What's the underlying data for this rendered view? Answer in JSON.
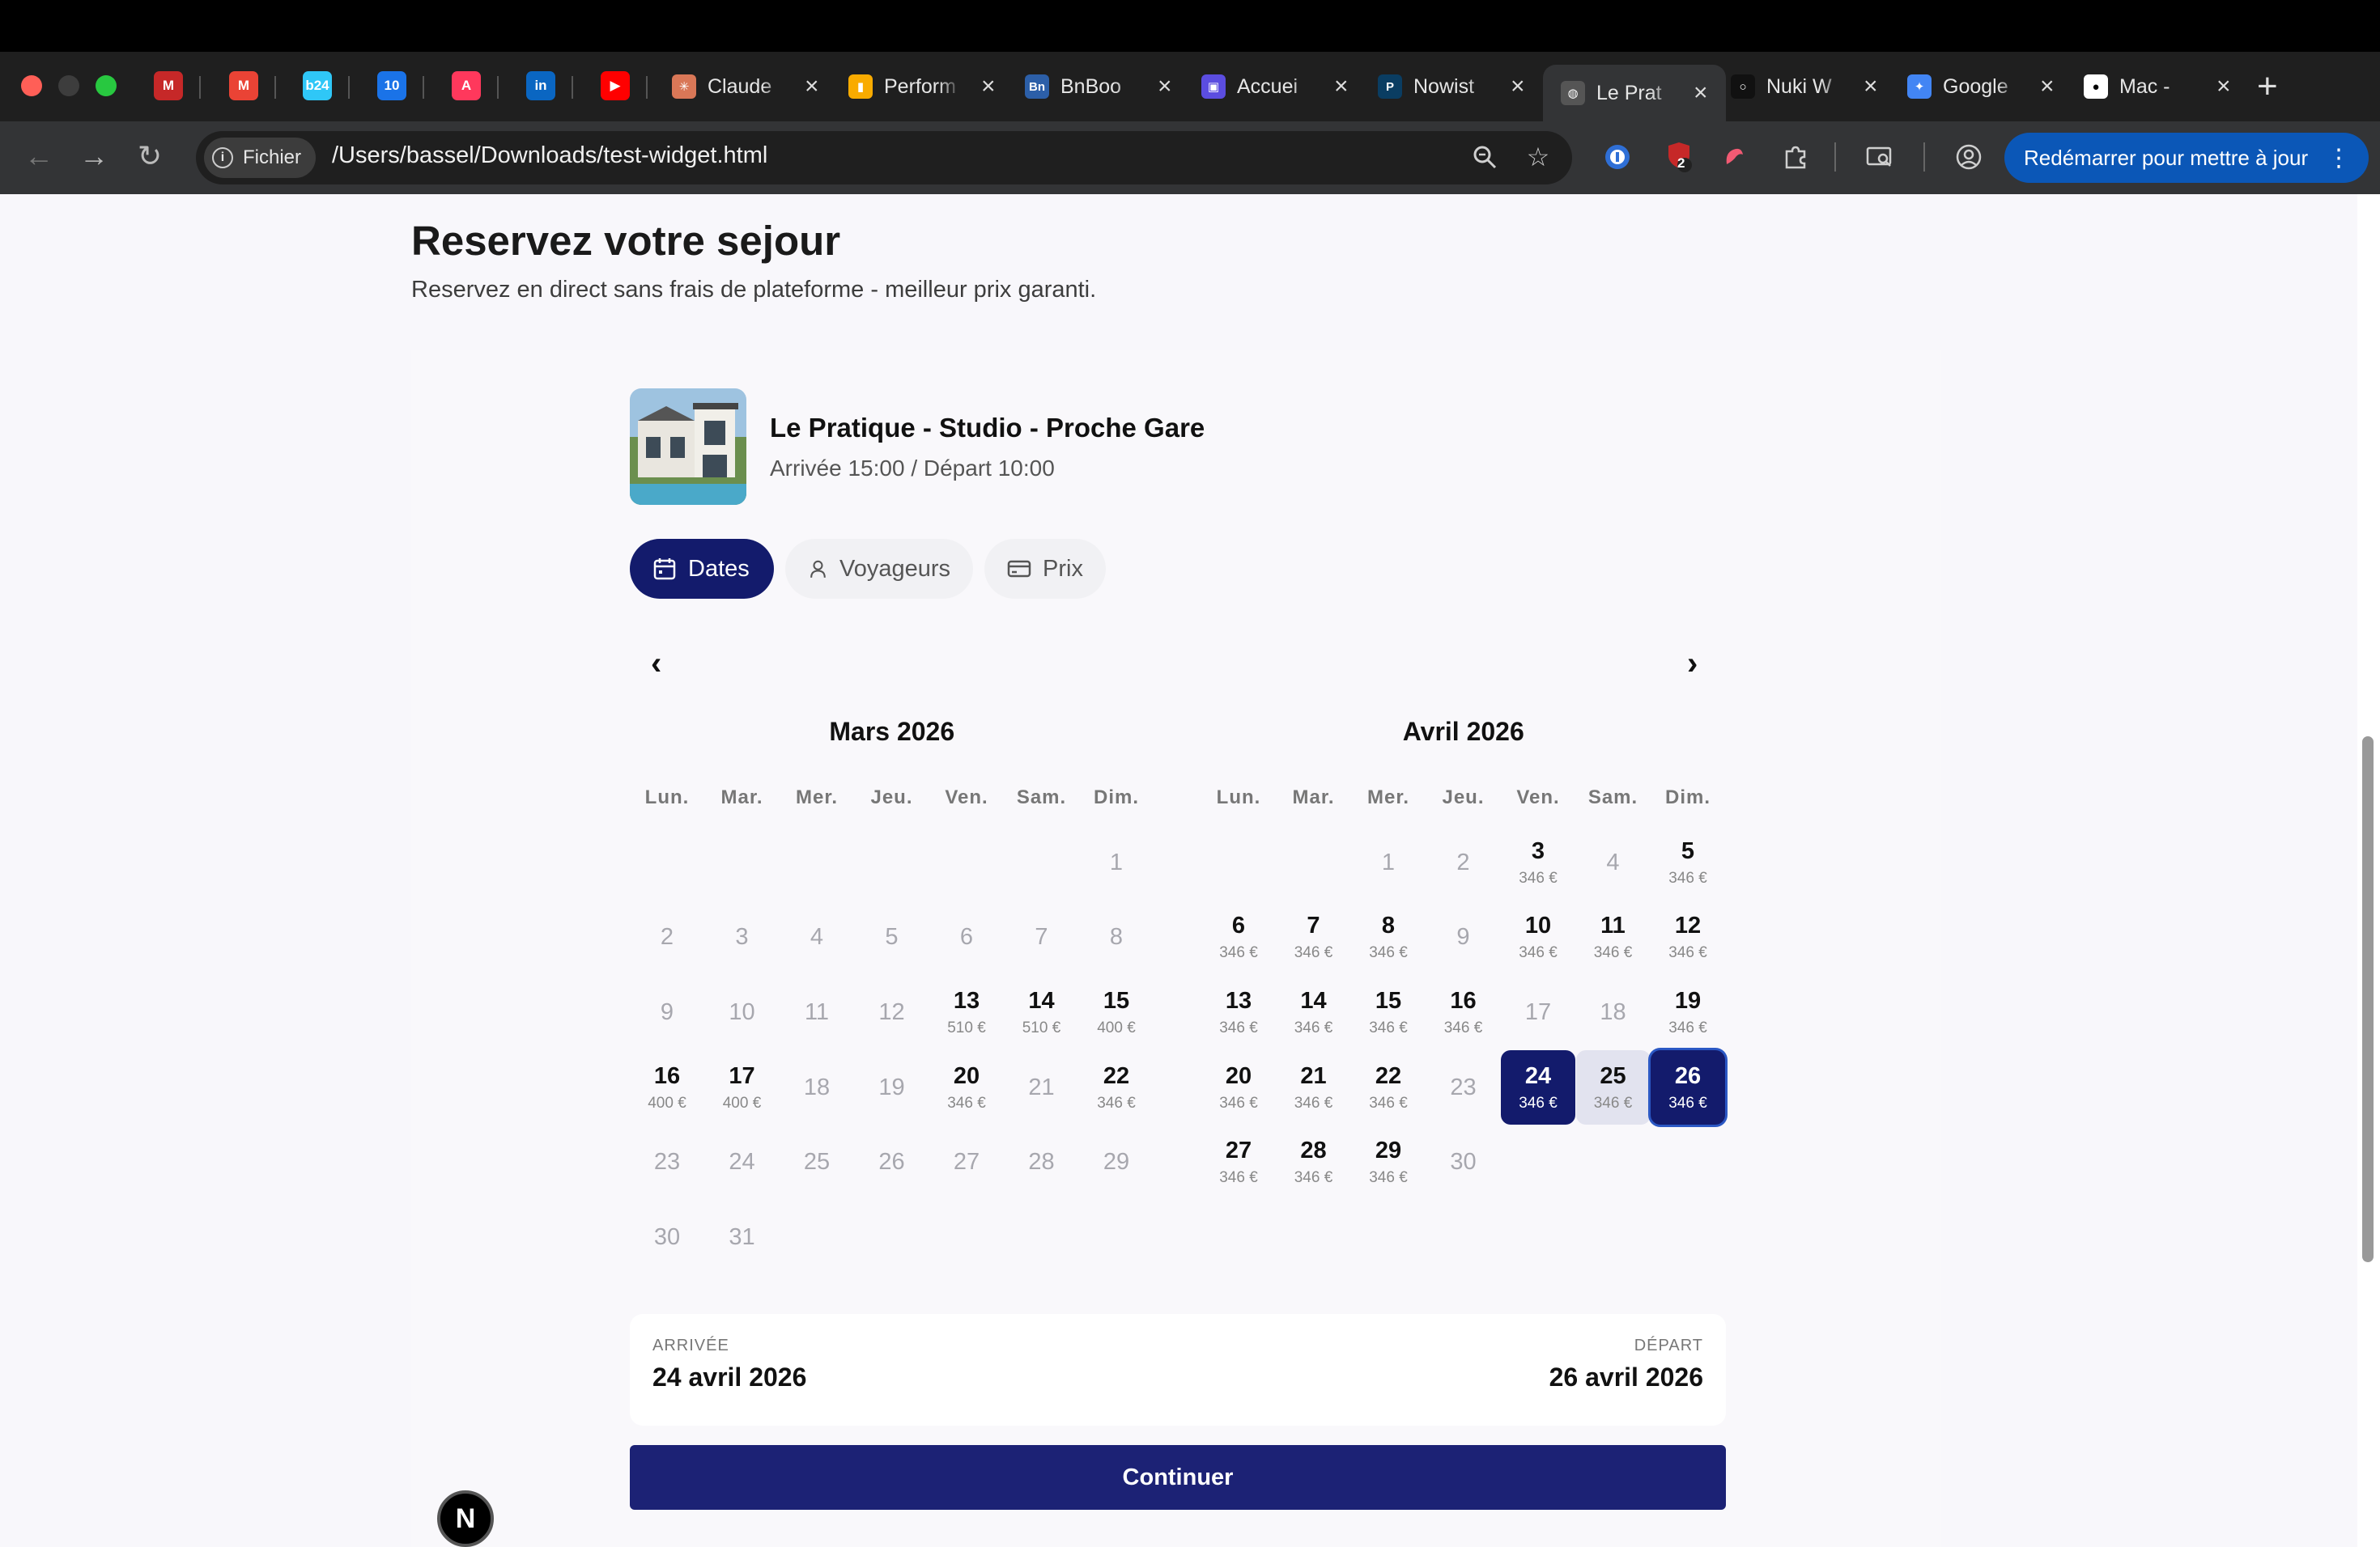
{
  "browser": {
    "pinned_tabs": [
      {
        "name": "gmail-zoho-icon",
        "label": "M",
        "color": "#c62828"
      },
      {
        "name": "gmail-icon",
        "label": "M",
        "color": "#ea4335"
      },
      {
        "name": "bitrix24-icon",
        "label": "b24",
        "color": "#2fc7f7"
      },
      {
        "name": "calendar-icon",
        "label": "10",
        "color": "#1a73e8"
      },
      {
        "name": "airbnb-icon",
        "label": "A",
        "color": "#ff385c"
      },
      {
        "name": "linkedin-icon",
        "label": "in",
        "color": "#0a66c2"
      },
      {
        "name": "youtube-icon",
        "label": "▶",
        "color": "#ff0000"
      }
    ],
    "tabs": [
      {
        "title": "Claude",
        "fav": "✳",
        "favcolor": "#d97757"
      },
      {
        "title": "Perform",
        "fav": "▮",
        "favcolor": "#f9ab00"
      },
      {
        "title": "BnBoo",
        "fav": "Bn",
        "favcolor": "#2c5fa8"
      },
      {
        "title": "Accuei",
        "fav": "▣",
        "favcolor": "#5b4de0"
      },
      {
        "title": "Nowist",
        "fav": "P",
        "favcolor": "#0a3d62"
      },
      {
        "title": "Le Prat",
        "fav": "◍",
        "favcolor": "#555"
      },
      {
        "title": "Nuki W",
        "fav": "○",
        "favcolor": "#111"
      },
      {
        "title": "Google",
        "fav": "✦",
        "favcolor": "#4285f4"
      },
      {
        "title": "Mac - ",
        "fav": "●",
        "favcolor": "#fff"
      }
    ],
    "new_tab": "+",
    "close": "×",
    "chip_label": "Fichier",
    "url": "/Users/bassel/Downloads/test-widget.html",
    "update_label": "Redémarrer pour mettre à jour",
    "badge_count": "2"
  },
  "page": {
    "title": "Reservez votre sejour",
    "subtitle": "Reservez en direct sans frais de plateforme - meilleur prix garanti.",
    "property": {
      "name": "Le Pratique - Studio - Proche Gare",
      "times": "Arrivée 15:00 / Départ 10:00"
    },
    "steps": {
      "dates": "Dates",
      "guests": "Voyageurs",
      "price": "Prix"
    },
    "weekdays": [
      "Lun.",
      "Mar.",
      "Mer.",
      "Jeu.",
      "Ven.",
      "Sam.",
      "Dim."
    ],
    "months": [
      {
        "title": "Mars 2026",
        "offset": 6,
        "days": [
          {
            "d": "1",
            "s": "dis"
          },
          {
            "d": "2",
            "s": "dis"
          },
          {
            "d": "3",
            "s": "dis"
          },
          {
            "d": "4",
            "s": "dis"
          },
          {
            "d": "5",
            "s": "dis"
          },
          {
            "d": "6",
            "s": "dis"
          },
          {
            "d": "7",
            "s": "dis"
          },
          {
            "d": "8",
            "s": "dis"
          },
          {
            "d": "9",
            "s": "dis"
          },
          {
            "d": "10",
            "s": "dis"
          },
          {
            "d": "11",
            "s": "dis"
          },
          {
            "d": "12",
            "s": "dis"
          },
          {
            "d": "13",
            "s": "av",
            "p": "510 €"
          },
          {
            "d": "14",
            "s": "av",
            "p": "510 €"
          },
          {
            "d": "15",
            "s": "av",
            "p": "400 €"
          },
          {
            "d": "16",
            "s": "av",
            "p": "400 €"
          },
          {
            "d": "17",
            "s": "av",
            "p": "400 €"
          },
          {
            "d": "18",
            "s": "dis"
          },
          {
            "d": "19",
            "s": "dis"
          },
          {
            "d": "20",
            "s": "av",
            "p": "346 €"
          },
          {
            "d": "21",
            "s": "dis"
          },
          {
            "d": "22",
            "s": "av",
            "p": "346 €"
          },
          {
            "d": "23",
            "s": "dis"
          },
          {
            "d": "24",
            "s": "dis"
          },
          {
            "d": "25",
            "s": "dis"
          },
          {
            "d": "26",
            "s": "dis"
          },
          {
            "d": "27",
            "s": "dis"
          },
          {
            "d": "28",
            "s": "dis"
          },
          {
            "d": "29",
            "s": "dis"
          },
          {
            "d": "30",
            "s": "dis"
          },
          {
            "d": "31",
            "s": "dis"
          }
        ]
      },
      {
        "title": "Avril 2026",
        "offset": 2,
        "days": [
          {
            "d": "1",
            "s": "dis"
          },
          {
            "d": "2",
            "s": "dis"
          },
          {
            "d": "3",
            "s": "av",
            "p": "346 €"
          },
          {
            "d": "4",
            "s": "dis"
          },
          {
            "d": "5",
            "s": "av",
            "p": "346 €"
          },
          {
            "d": "6",
            "s": "av",
            "p": "346 €"
          },
          {
            "d": "7",
            "s": "av",
            "p": "346 €"
          },
          {
            "d": "8",
            "s": "av",
            "p": "346 €"
          },
          {
            "d": "9",
            "s": "dis"
          },
          {
            "d": "10",
            "s": "av",
            "p": "346 €"
          },
          {
            "d": "11",
            "s": "av",
            "p": "346 €"
          },
          {
            "d": "12",
            "s": "av",
            "p": "346 €"
          },
          {
            "d": "13",
            "s": "av",
            "p": "346 €"
          },
          {
            "d": "14",
            "s": "av",
            "p": "346 €"
          },
          {
            "d": "15",
            "s": "av",
            "p": "346 €"
          },
          {
            "d": "16",
            "s": "av",
            "p": "346 €"
          },
          {
            "d": "17",
            "s": "dis"
          },
          {
            "d": "18",
            "s": "dis"
          },
          {
            "d": "19",
            "s": "av",
            "p": "346 €"
          },
          {
            "d": "20",
            "s": "av",
            "p": "346 €"
          },
          {
            "d": "21",
            "s": "av",
            "p": "346 €"
          },
          {
            "d": "22",
            "s": "av",
            "p": "346 €"
          },
          {
            "d": "23",
            "s": "dis"
          },
          {
            "d": "24",
            "s": "sel",
            "p": "346 €"
          },
          {
            "d": "25",
            "s": "mid",
            "p": "346 €"
          },
          {
            "d": "26",
            "s": "sel end",
            "p": "346 €"
          },
          {
            "d": "27",
            "s": "av",
            "p": "346 €"
          },
          {
            "d": "28",
            "s": "av",
            "p": "346 €"
          },
          {
            "d": "29",
            "s": "av",
            "p": "346 €"
          },
          {
            "d": "30",
            "s": "dis"
          }
        ]
      }
    ],
    "summary": {
      "arrival_label": "ARRIVÉE",
      "arrival_value": "24 avril 2026",
      "departure_label": "DÉPART",
      "departure_value": "26 avril 2026"
    },
    "continue_label": "Continuer",
    "n_badge": "N"
  },
  "colors": {
    "accent": "#131b6c",
    "button": "#1c2275",
    "range": "#e2e3ef"
  }
}
